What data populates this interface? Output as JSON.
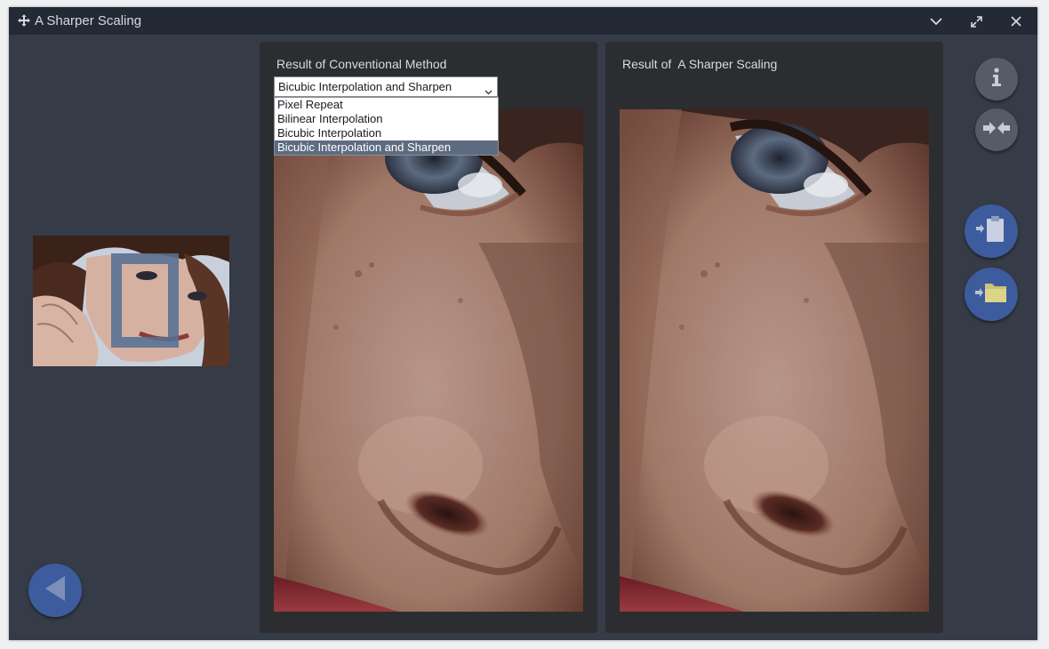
{
  "window": {
    "title": "A Sharper Scaling",
    "icons": {
      "app": "move-arrows-icon",
      "minimize": "chevron-down-icon",
      "maximize": "expand-icon",
      "close": "close-icon"
    }
  },
  "left_pane": {
    "thumbnail": "portrait-thumbnail-image",
    "back_icon": "back-triangle-icon"
  },
  "conventional_panel": {
    "title": "Result of Conventional Method",
    "method_select": {
      "value": "Bicubic Interpolation and Sharpen",
      "options": [
        "Pixel Repeat",
        "Bilinear Interpolation",
        "Bicubic Interpolation",
        "Bicubic Interpolation and Sharpen"
      ],
      "highlighted_index": 3
    }
  },
  "sharper_panel": {
    "title": "Result of  A Sharper Scaling"
  },
  "toolbar": {
    "info_icon": "info-icon",
    "compare_icon": "compare-arrows-icon",
    "clipboard_icon": "paste-clipboard-icon",
    "folder_icon": "open-folder-icon"
  },
  "colors": {
    "window_bg": "#353b47",
    "titlebar_bg": "#232a36",
    "panel_bg": "#2b2d30",
    "accent_blue": "#3d5c9d",
    "grey_button": "#555c68",
    "selection_highlight": "#5d6c80"
  }
}
